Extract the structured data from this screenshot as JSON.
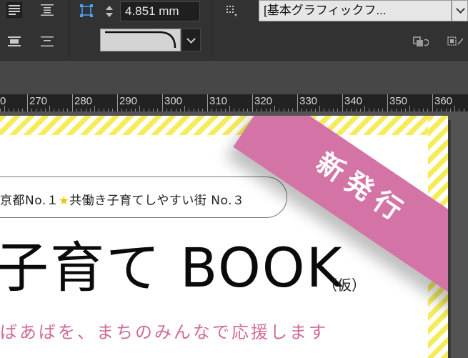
{
  "control_panel": {
    "dimension_value": "4.851 mm",
    "object_style": "[基本グラフィックフ...",
    "stroke_style_preview_icon": "corner-curve-icon"
  },
  "ruler": {
    "labels": [
      "0",
      "270",
      "280",
      "290",
      "300",
      "310",
      "320",
      "330",
      "340",
      "350",
      "360"
    ]
  },
  "document": {
    "ribbon_text": "新発行",
    "tagline_left": "京都No.１",
    "tagline_star": "★",
    "tagline_right": "共働き子育てしやすい街 No.３",
    "main_title": "子育て BOOK",
    "title_note": "（仮）",
    "subtitle": "ばあばを、まちのみんなで応援します",
    "colors": {
      "ribbon": "#d474a6",
      "stripes": "#f6ec5a",
      "subtitle": "#cf6b9b",
      "star": "#f0c200"
    }
  }
}
